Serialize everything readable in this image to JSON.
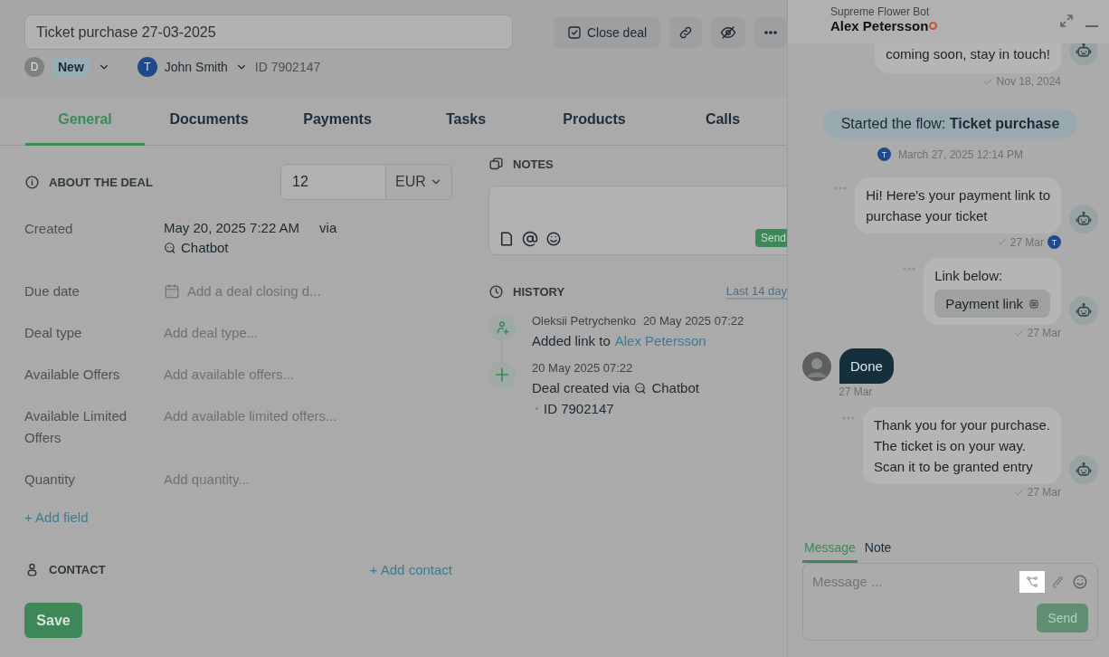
{
  "deal": {
    "title": "Ticket purchase 27-03-2025",
    "stage_avatar": "D",
    "stage": "New",
    "owner_avatar": "T",
    "owner": "John Smith",
    "id": "ID 7902147"
  },
  "toolbar": {
    "close_deal": "Close deal"
  },
  "tabs": [
    {
      "label": "General",
      "selected": true
    },
    {
      "label": "Documents",
      "selected": false
    },
    {
      "label": "Payments",
      "selected": false
    },
    {
      "label": "Tasks",
      "selected": false
    },
    {
      "label": "Products",
      "selected": false
    },
    {
      "label": "Calls",
      "selected": false
    }
  ],
  "about": {
    "heading": "ABOUT THE DEAL",
    "amount": "12",
    "currency": "EUR",
    "add_field": "+ Add field",
    "fields": [
      {
        "kind": "created",
        "label": "Created",
        "value": "May 20, 2025 7:22 AM",
        "via": "via",
        "source": "Chatbot"
      },
      {
        "kind": "date",
        "label": "Due date",
        "placeholder": "Add a deal closing d..."
      },
      {
        "kind": "text",
        "label": "Deal type",
        "placeholder": "Add deal type..."
      },
      {
        "kind": "text",
        "label": "Available Offers",
        "placeholder": "Add available offers..."
      },
      {
        "kind": "text",
        "label": "Available Limited Offers",
        "placeholder": "Add available limited offers..."
      },
      {
        "kind": "text",
        "label": "Quantity",
        "placeholder": "Add quantity..."
      }
    ]
  },
  "contact": {
    "heading": "CONTACT",
    "add": "+ Add contact"
  },
  "save": "Save",
  "notes": {
    "heading": "NOTES",
    "send": "Send"
  },
  "history": {
    "heading": "HISTORY",
    "filter": "Last 14 day",
    "events": [
      {
        "kind": "link",
        "author": "Oleksii Petrychenko",
        "time": "20 May 2025 07:22",
        "text": "Added link to",
        "link": "Alex Petersson"
      },
      {
        "kind": "created",
        "time": "20 May 2025 07:22",
        "text": "Deal created via",
        "source": "Chatbot",
        "id": "ID 7902147"
      }
    ]
  },
  "chat": {
    "bot": "Supreme Flower Bot",
    "contact": "Alex Petersson",
    "online": false,
    "messages": [
      {
        "kind": "bot",
        "lines": [
          "coming soon, stay in touch!"
        ],
        "time": "Nov 18, 2024",
        "partial": true
      },
      {
        "kind": "flow",
        "text": "Started the flow: **Ticket purchase**",
        "avatar": "T",
        "time": "March 27, 2025 12:14 PM"
      },
      {
        "kind": "bot",
        "lines": [
          "Hi! Here's your payment link to",
          "purchase your ticket"
        ],
        "time": "27 Mar",
        "avatar": "T"
      },
      {
        "kind": "bot",
        "lines": [
          "Link below:"
        ],
        "link": "Payment link",
        "time": "27 Mar"
      },
      {
        "kind": "client",
        "lines": [
          "Done"
        ],
        "time": "27 Mar"
      },
      {
        "kind": "bot",
        "lines": [
          "Thank you for your purchase.",
          "The ticket is on your way.",
          "Scan it to be granted entry"
        ],
        "time": "27 Mar"
      }
    ]
  },
  "composer": {
    "tabs": [
      {
        "label": "Message",
        "selected": true
      },
      {
        "label": "Note",
        "selected": false
      }
    ],
    "placeholder": "Message ...",
    "send": "Send"
  }
}
